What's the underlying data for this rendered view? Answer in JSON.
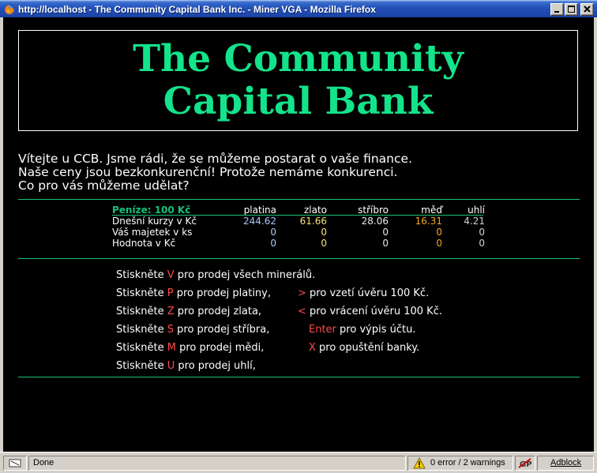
{
  "window": {
    "title": "http://localhost - The Community Capital Bank Inc. - Miner VGA - Mozilla Firefox",
    "icon": "firefox-icon"
  },
  "page": {
    "banner": "The Community Capital Bank",
    "intro": [
      "Vítejte u CCB. Jsme rádi, že se můžeme postarat o vaše finance.",
      "Naše ceny jsou bezkonkurenční! Protože nemáme konkurenci.",
      "Co pro vás můžeme udělat?"
    ],
    "table": {
      "money_label": "Peníze: 100  Kč",
      "headers": [
        "platina",
        "zlato",
        "stříbro",
        "měď",
        "uhlí"
      ],
      "rows": [
        {
          "label": "Dnešní kurzy v Kč",
          "values": [
            "244.62",
            "61.66",
            "28.06",
            "16.31",
            "4.21"
          ]
        },
        {
          "label": "Váš majetek v ks",
          "values": [
            "0",
            "0",
            "0",
            "0",
            "0"
          ]
        },
        {
          "label": "Hodnota v Kč",
          "values": [
            "0",
            "0",
            "0",
            "0",
            "0"
          ]
        }
      ]
    },
    "menu": {
      "prefix": "Stiskněte",
      "lines": [
        {
          "key": "V",
          "text": "pro prodej všech minerálů."
        },
        {
          "key": "P",
          "text": "pro prodej platiny,",
          "key2": ">",
          "text2": "pro vzetí úvěru 100 Kč."
        },
        {
          "key": "Z",
          "text": "pro prodej zlata,",
          "key2": "<",
          "text2": "pro vrácení úvěru 100 Kč."
        },
        {
          "key": "S",
          "text": "pro prodej stříbra,",
          "key2": "Enter",
          "text2": "pro výpis účtu."
        },
        {
          "key": "M",
          "text": "pro prodej mědi,",
          "key2": "X",
          "text2": "pro opuštění banky."
        },
        {
          "key": "U",
          "text": "pro prodej uhlí,"
        }
      ]
    }
  },
  "statusbar": {
    "status": "Done",
    "errors": "0 error / 2 warnings",
    "adblock": "Adblock"
  },
  "colors": {
    "banner_green": "#13e38a",
    "rule_green": "#18c176",
    "key_red": "#ff4a4a",
    "platinum_blue": "#a8c8f8",
    "gold_yellow": "#f5e17a",
    "copper_orange": "#f5a623"
  }
}
